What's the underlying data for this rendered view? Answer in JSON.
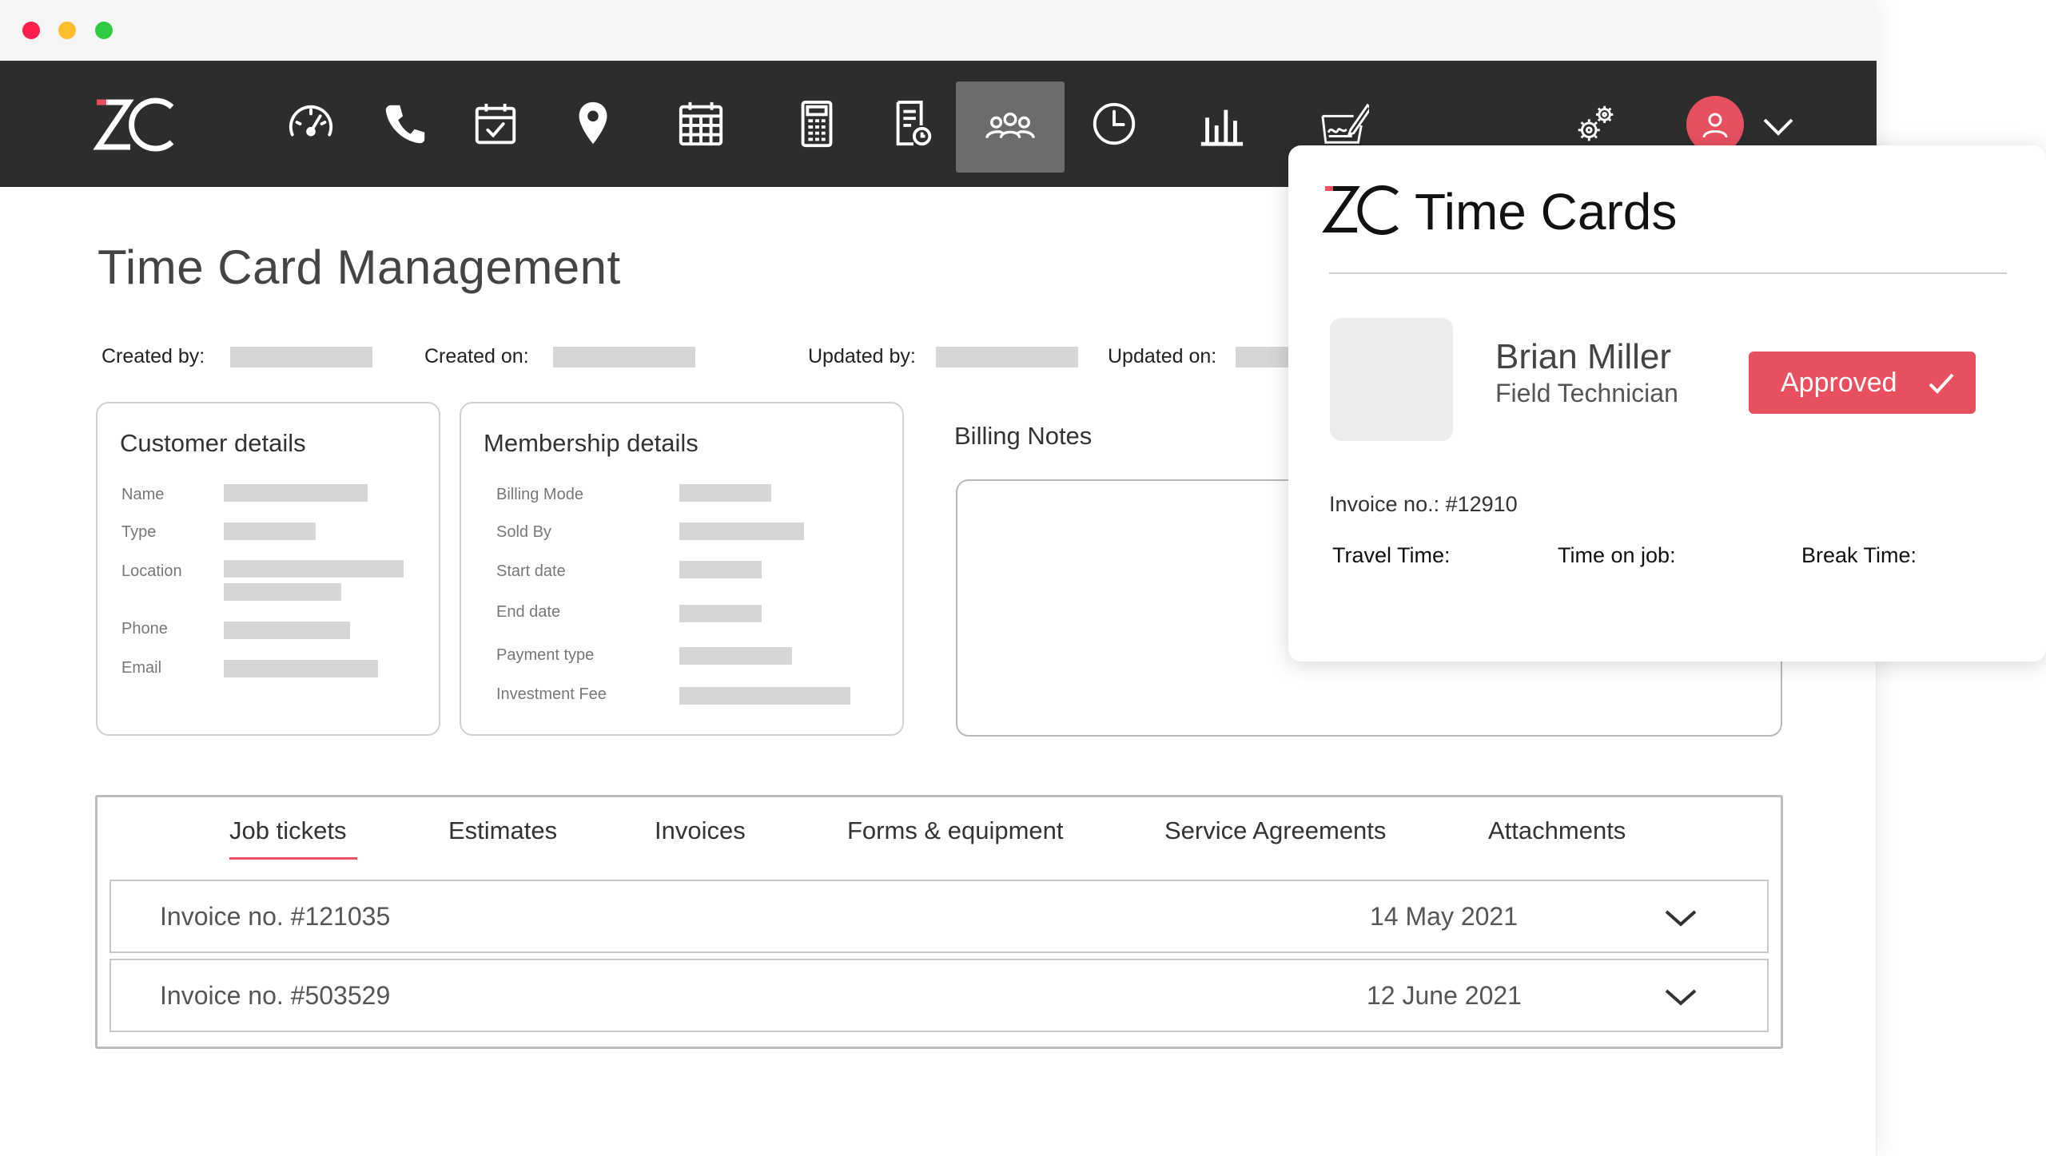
{
  "window": {
    "controls": [
      "close",
      "minimize",
      "maximize"
    ]
  },
  "nav": {
    "logo": "ZC",
    "icons": [
      "dashboard-icon",
      "phone-icon",
      "calendar-check-icon",
      "location-pin-icon",
      "calendar-grid-icon",
      "calculator-icon",
      "document-icon",
      "team-icon",
      "clock-icon",
      "bar-chart-icon",
      "signature-icon",
      "settings-gears-icon",
      "user-icon",
      "chevron-down-icon"
    ],
    "active": "team-icon"
  },
  "page": {
    "title": "Time Card Management",
    "meta": {
      "created_by_label": "Created by:",
      "created_on_label": "Created on:",
      "updated_by_label": "Updated by:",
      "updated_on_label": "Updated on:"
    }
  },
  "customer": {
    "title": "Customer details",
    "fields": [
      "Name",
      "Type",
      "Location",
      "Phone",
      "Email"
    ]
  },
  "membership": {
    "title": "Membership details",
    "fields": [
      "Billing Mode",
      "Sold By",
      "Start date",
      "End date",
      "Payment type",
      "Investment Fee"
    ]
  },
  "billing": {
    "title": "Billing Notes"
  },
  "tabs": [
    "Job tickets",
    "Estimates",
    "Invoices",
    "Forms & equipment",
    "Service Agreements",
    "Attachments"
  ],
  "active_tab": "Job tickets",
  "invoices": [
    {
      "number": "Invoice no. #121035",
      "date": "14 May 2021"
    },
    {
      "number": "Invoice no. #503529",
      "date": "12 June 2021"
    }
  ],
  "popup": {
    "logo": "ZC",
    "title": "Time Cards",
    "name": "Brian Miller",
    "role": "Field Technician",
    "status": "Approved",
    "invoice": "Invoice no.: #12910",
    "travel_label": "Travel Time:",
    "job_label": "Time on job:",
    "break_label": "Break Time:"
  },
  "colors": {
    "accent": "#e8505f",
    "nav_bg": "#2d2d2d",
    "nav_active": "#6c6c6c",
    "placeholder": "#d6d6d6"
  }
}
